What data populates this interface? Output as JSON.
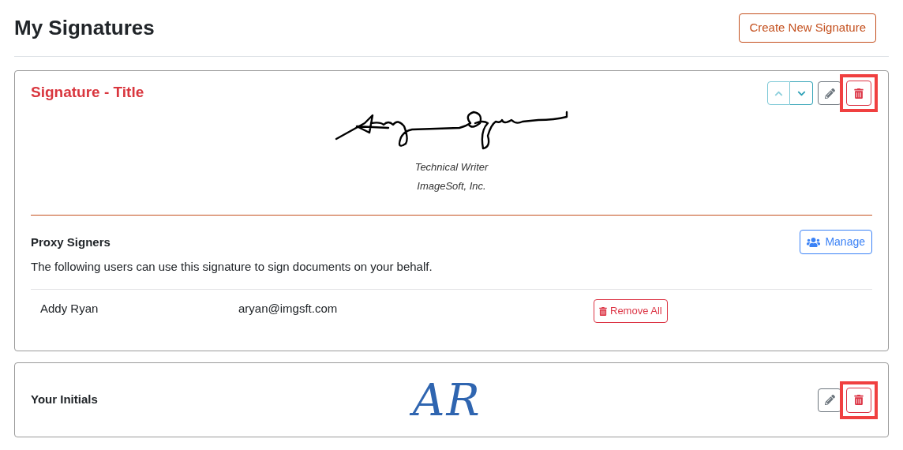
{
  "page": {
    "title": "My Signatures",
    "create_button": "Create New Signature"
  },
  "signature": {
    "title": "Signature - Title",
    "job_title": "Technical Writer",
    "company": "ImageSoft, Inc.",
    "delete_highlighted": true,
    "proxy": {
      "heading": "Proxy Signers",
      "description": "The following users can use this signature to sign documents on your behalf.",
      "manage_button": "Manage",
      "rows": [
        {
          "name": "Addy Ryan",
          "email": "aryan@imgsft.com",
          "action": "Remove All"
        }
      ]
    }
  },
  "initials": {
    "label": "Your Initials",
    "text": "AR",
    "delete_highlighted": true
  }
}
